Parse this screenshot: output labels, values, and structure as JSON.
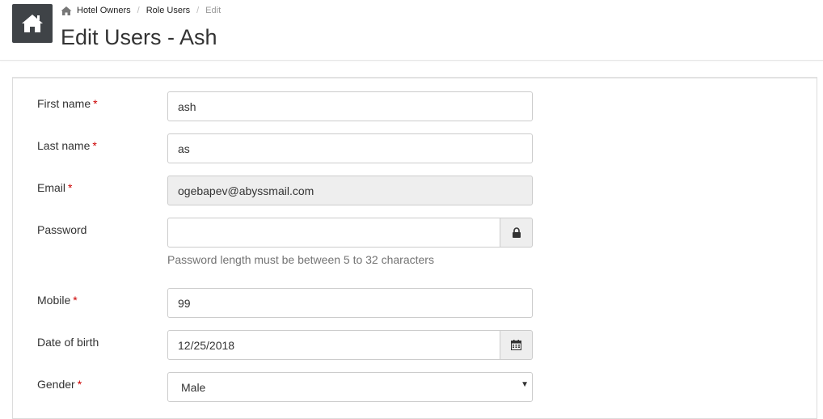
{
  "breadcrumb": {
    "items": [
      "Hotel Owners",
      "Role Users"
    ],
    "active": "Edit"
  },
  "page": {
    "title": "Edit Users - Ash"
  },
  "form": {
    "required_marker": "*",
    "first_name": {
      "label": "First name",
      "value": "ash"
    },
    "last_name": {
      "label": "Last name",
      "value": "as"
    },
    "email": {
      "label": "Email",
      "value": "ogebapev@abyssmail.com"
    },
    "password": {
      "label": "Password",
      "value": "",
      "help": "Password length must be between 5 to 32 characters"
    },
    "mobile": {
      "label": "Mobile",
      "value": "99"
    },
    "dob": {
      "label": "Date of birth",
      "value": "12/25/2018"
    },
    "gender": {
      "label": "Gender",
      "value": "Male"
    }
  },
  "icons": {
    "home": "home-icon",
    "lock": "lock-icon",
    "calendar": "calendar-icon",
    "caret": "chevron-down-icon"
  },
  "colors": {
    "home_tile": "#3f4347",
    "required": "#cc0000",
    "readonly_bg": "#eeeeee"
  }
}
